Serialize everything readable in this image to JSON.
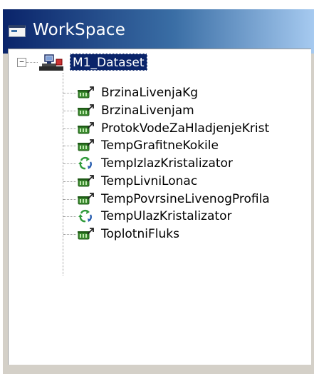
{
  "window": {
    "title": "WorkSpace",
    "title_icon": "window-icon"
  },
  "tree": {
    "expander": "−",
    "root": {
      "label": "M1_Dataset",
      "icon": "dataset-icon"
    },
    "items": [
      {
        "label": "BrzinaLivenjaKg",
        "icon": "tank-icon"
      },
      {
        "label": "BrzinaLivenjam",
        "icon": "tank-icon"
      },
      {
        "label": "ProtokVodeZaHladjenjeKrist",
        "icon": "tank-icon"
      },
      {
        "label": "TempGrafitneKokile",
        "icon": "tank-icon"
      },
      {
        "label": "TempIzlazKristalizator",
        "icon": "cycle-icon"
      },
      {
        "label": "TempLivniLonac",
        "icon": "tank-icon"
      },
      {
        "label": "TempPovrsineLivenogProfila",
        "icon": "tank-icon"
      },
      {
        "label": "TempUlazKristalizator",
        "icon": "cycle-icon"
      },
      {
        "label": "ToplotniFluks",
        "icon": "tank-icon"
      }
    ]
  },
  "colors": {
    "title_gradient_start": "#0a246a",
    "title_gradient_end": "#a6caf0",
    "selection": "#0a246a",
    "tank_green": "#3a8a2e",
    "cycle_green": "#2f9a3a",
    "cycle_blue": "#2a5fb0"
  }
}
